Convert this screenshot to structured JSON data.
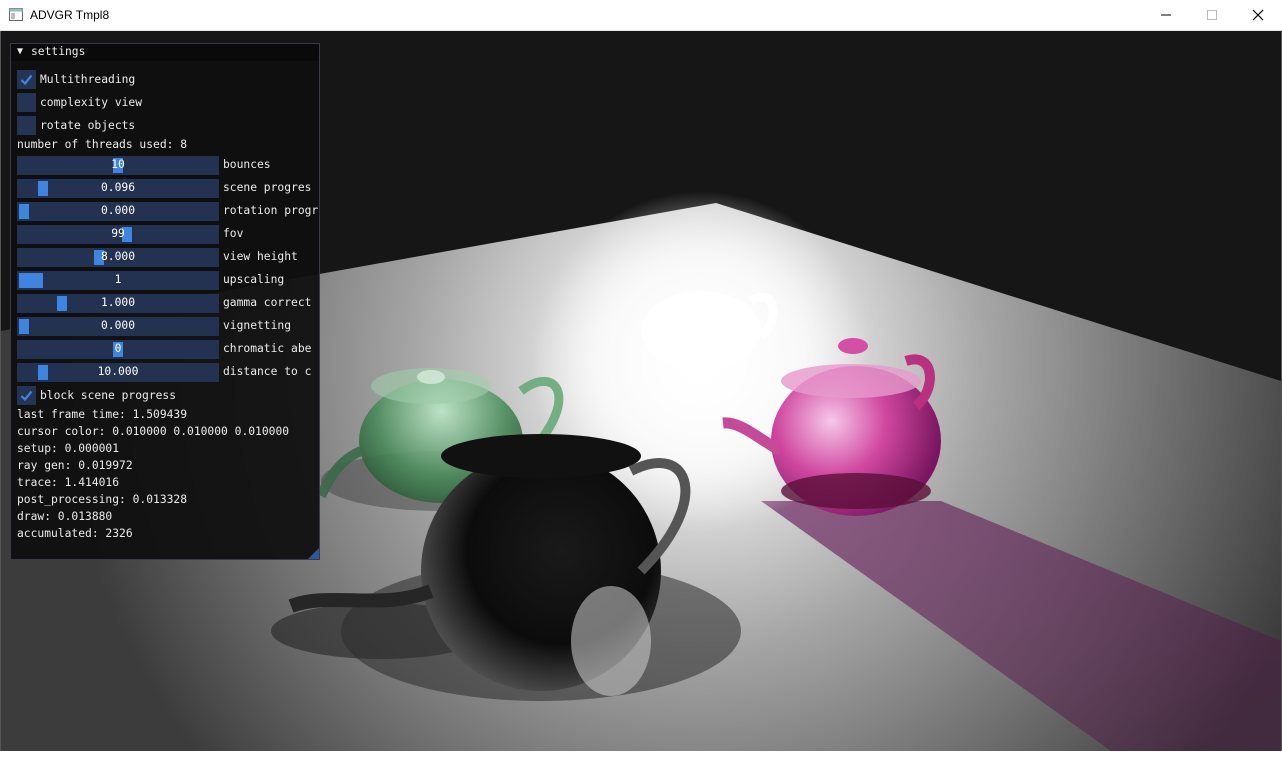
{
  "window": {
    "title": "ADVGR Tmpl8"
  },
  "panel": {
    "title": "settings",
    "checkboxes": [
      {
        "label": "Multithreading",
        "checked": true
      },
      {
        "label": "complexity view",
        "checked": false
      },
      {
        "label": "rotate objects",
        "checked": false
      }
    ],
    "threads_text": "number of threads used: 8",
    "sliders": [
      {
        "label": "bounces",
        "value": "10",
        "fraction": 0.5
      },
      {
        "label": "scene progres",
        "value": "0.096",
        "fraction": 0.1
      },
      {
        "label": "rotation progr",
        "value": "0.000",
        "fraction": 0.0
      },
      {
        "label": "fov",
        "value": "99",
        "fraction": 0.55
      },
      {
        "label": "view height",
        "value": "8.000",
        "fraction": 0.4
      },
      {
        "label": "upscaling",
        "value": "1",
        "fraction": 0.0
      },
      {
        "label": "gamma correct",
        "value": "1.000",
        "fraction": 0.2
      },
      {
        "label": "vignetting",
        "value": "0.000",
        "fraction": 0.0
      },
      {
        "label": "chromatic abe",
        "value": "0",
        "fraction": 0.5
      },
      {
        "label": "distance to c",
        "value": "10.000",
        "fraction": 0.1
      }
    ],
    "block_checkbox": {
      "label": "block scene progress",
      "checked": true
    },
    "stats": [
      "last frame time: 1.509439",
      "cursor color: 0.010000 0.010000 0.010000",
      "setup: 0.000001",
      "ray gen: 0.019972",
      "trace: 1.414016",
      "post_processing: 0.013328",
      "draw: 0.013880",
      "accumulated: 2326"
    ]
  },
  "colors": {
    "accent": "#3d85e0",
    "frame_bg": "#233251",
    "panel_bg": "#0f0f0f",
    "teapot_green": "#2f7a4a",
    "teapot_pink": "#c02a9a",
    "teapot_black": "#0c0c0c",
    "teapot_white": "#ffffff"
  }
}
